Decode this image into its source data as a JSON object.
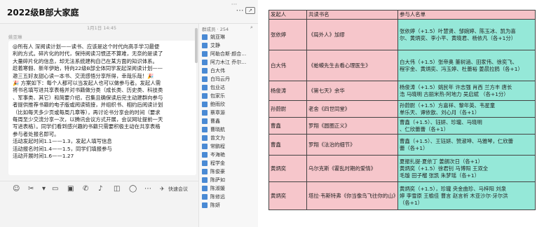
{
  "chat": {
    "title": "2022级B部大家庭",
    "header_icons": {
      "more": "⋯",
      "share": "↗",
      "dots": "···"
    },
    "timestamp": "1月1日 14:45",
    "sender": "姚亚琳",
    "message_lines": [
      "@所有人 深阅读计划——读书、应该是这个时代向高手学习最便",
      "利的方式。碎片化的时代，保持阅读习惯还不算难，无奈的是读了",
      "大量碎片化的信息，却无法系统建构自己在某方面的知识体系。",
      "趁着寒假、新年伊始，特向22级B部全体同学发起深阅读计划——",
      "邀三五好友甜心读一本书、交流感悟分享所得，幸哉乐哉！🎉",
      "🎉 方案如下：每个人都可以当发起人也可以做参与者。发起人需",
      "将书名填写进共享表格并对书籍做分类（成长类、历史类、科技类",
      "、军事类、其它）和简要介绍，召集且确保读后完主动建群向参与",
      "者提供推荐书籍的电子版或阅读链接，并组织书、相约后阅读计划",
      "（比如每天多少页或每周几章等），再讨论书分享会的时间（要求",
      "每周至少交流分享一次，以腾讯会议方式开展，会议网址提前一天",
      "写进表格）。同学们看到感兴趣的书籍只需要积极主动在共享表格",
      "参与者处报名即可。",
      "活动发起时间1.1——1.3，发起人填写信息",
      "活动报名时间1.4——1.5，同学们填报参与",
      "活动开展时间1.6——1.27"
    ],
    "members": {
      "title": "群成员 · 254",
      "list": [
        "姚亚琳",
        "艾静",
        "阿勒合斯·颜合…",
        "阿力木江 乔尔…",
        "白大伟",
        "白玛云丹",
        "包业达",
        "包家乐",
        "鲍雨欣",
        "蔡章源",
        "曹鑫",
        "曹晓航",
        "曾文为",
        "常鹏程",
        "岑海艳",
        "程学金",
        "陈俊豪",
        "陈萨如",
        "陈淑媛",
        "陈修远",
        "陈妍"
      ]
    },
    "toolbar": {
      "quick_meeting": "快速会议"
    }
  },
  "table": {
    "headers": [
      "发起人",
      "共读书名",
      "参与人名单"
    ],
    "rows": [
      {
        "initiator": "张依婷",
        "book": "《局外人》加缪",
        "participants": [
          "张依婷（+1.5）叶慧贤、邹婉婷、陈玉冰、凯为喜",
          "尔、黄炳奕、李小平、黄晓君、杨依凡（各+1分）"
        ]
      },
      {
        "initiator": "白大伟",
        "book": "《蛤蟆先生去看心理医生》",
        "participants": [
          "白大伟（+1.5）张帝奥 董树涵、田家伟、徐奕飞、",
          "程宇金、黄炳奕、冯玉婷、杜蕾裕 姜晨拉鸥（各+1）"
        ]
      },
      {
        "initiator": "杨俊涛",
        "book": "《第七天》余华",
        "participants": [
          "杨俊涛（+1.5）姚民年 许志强 肖西 兰方丰 唐长",
          "浩 马晓明 古丽米热·阿地力 吴启斌 （各+1分）"
        ]
      },
      {
        "initiator": "孙蔚尉",
        "book": "老舍《四世同堂》",
        "participants": [
          "孙蔚尉（+1.5）方嘉祥、黎年英、韦星童",
          "单乐天、谭依歆、刘心月（各+1）"
        ]
      },
      {
        "initiator": "曹鑫",
        "book": "罗翔《圆圈正义》",
        "participants": [
          "曹鑫（+1.5）、钰妍、珍瓏、马晓明",
          "、仁欣蕾蕾（各+1）"
        ]
      },
      {
        "initiator": "曹鑫",
        "book": "罗翔《法治的细节》",
        "participants": [
          "曹鑫（+1.5）、王钰妍、赞淑坤、马雅琴，仁欣蕾",
          "蕾（各+1）"
        ]
      },
      {
        "initiator": "黄炳奕",
        "book": "乌尔克斯《霍乱时期的爱情》",
        "participants": [
          "夏振扎提·夏依丁 姜朗次日（各+1）",
          "黄炳奕（+1.5）徐君钊 马博阳 王双全",
          "毛璇 田子榴 张凯 朱梦瑶（各+1）"
        ]
      },
      {
        "initiator": "黄炳奕",
        "book": "塔拉·韦斯特弗《你当像鸟飞往你的山》",
        "participants": [
          "黄炳奕（+1.5），珍瓏 央金曲珍、马梓阳 刘泉",
          "婷 李雪原 王榆佳 曹言 赵言祈 木亚沙尔·牙尔洪",
          "（各+1）"
        ]
      }
    ]
  },
  "colors": {
    "header_bg": "#f5c2c7",
    "book_bg": "#f6c6cb",
    "participants_bg": "#95e8d8",
    "chat_bg": "#f3f3f3"
  }
}
